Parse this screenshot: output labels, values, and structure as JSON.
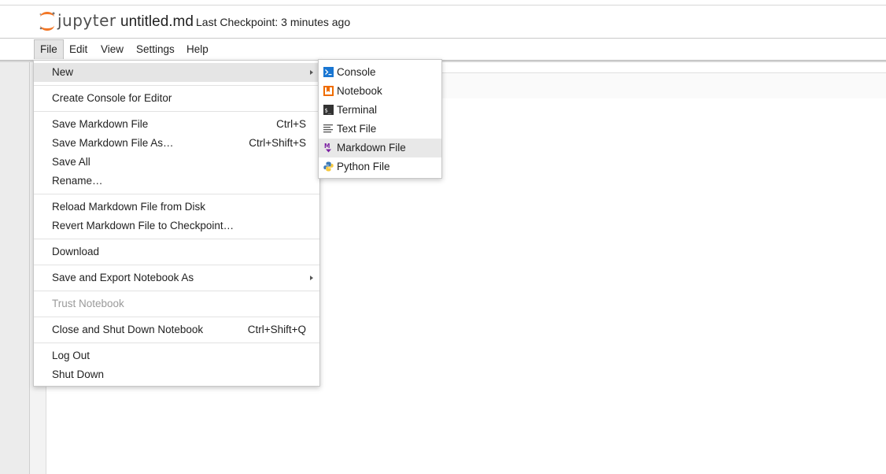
{
  "header": {
    "logo_text": "jupyter",
    "document_title": "untitled.md",
    "checkpoint_text": "Last Checkpoint: 3 minutes ago"
  },
  "menubar": {
    "items": [
      {
        "label": "File"
      },
      {
        "label": "Edit"
      },
      {
        "label": "View"
      },
      {
        "label": "Settings"
      },
      {
        "label": "Help"
      }
    ]
  },
  "file_menu": {
    "items": [
      {
        "label": "New",
        "shortcut": ""
      },
      {
        "label": "Create Console for Editor",
        "shortcut": ""
      },
      {
        "label": "Save Markdown File",
        "shortcut": "Ctrl+S"
      },
      {
        "label": "Save Markdown File As…",
        "shortcut": "Ctrl+Shift+S"
      },
      {
        "label": "Save All",
        "shortcut": ""
      },
      {
        "label": "Rename…",
        "shortcut": ""
      },
      {
        "label": "Reload Markdown File from Disk",
        "shortcut": ""
      },
      {
        "label": "Revert Markdown File to Checkpoint…",
        "shortcut": ""
      },
      {
        "label": "Download",
        "shortcut": ""
      },
      {
        "label": "Save and Export Notebook As",
        "shortcut": ""
      },
      {
        "label": "Trust Notebook",
        "shortcut": ""
      },
      {
        "label": "Close and Shut Down Notebook",
        "shortcut": "Ctrl+Shift+Q"
      },
      {
        "label": "Log Out",
        "shortcut": ""
      },
      {
        "label": "Shut Down",
        "shortcut": ""
      }
    ]
  },
  "new_submenu": {
    "items": [
      {
        "label": "Console",
        "icon": "console-icon"
      },
      {
        "label": "Notebook",
        "icon": "notebook-icon"
      },
      {
        "label": "Terminal",
        "icon": "terminal-icon"
      },
      {
        "label": "Text File",
        "icon": "text-file-icon"
      },
      {
        "label": "Markdown File",
        "icon": "markdown-icon"
      },
      {
        "label": "Python File",
        "icon": "python-icon"
      }
    ]
  },
  "colors": {
    "accent_orange": "#f37726",
    "console_blue": "#1976d2",
    "notebook_orange": "#ef6c00",
    "markdown_purple": "#7b1fa2",
    "menu_hover": "#e5e5e5"
  }
}
